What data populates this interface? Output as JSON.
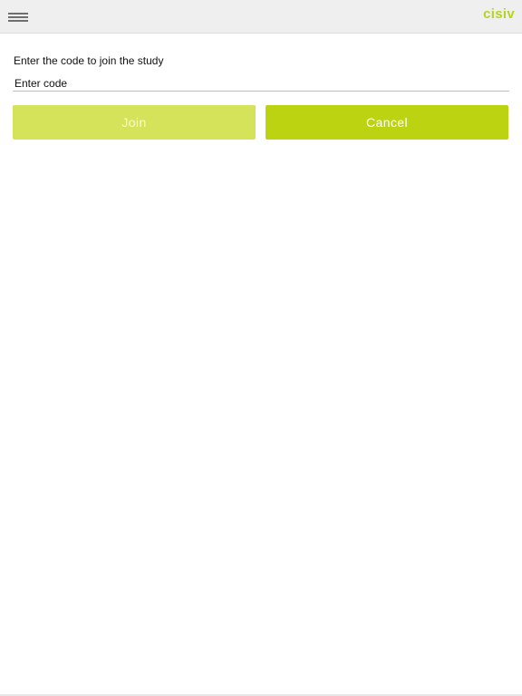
{
  "header": {
    "logo_text": "cisiv",
    "menu_icon": "hamburger-menu-icon",
    "accent_color": "#b8d21f"
  },
  "join_form": {
    "prompt": "Enter the code to join the study",
    "code_input": {
      "value": "",
      "placeholder": "Enter code"
    },
    "join_label": "Join",
    "cancel_label": "Cancel",
    "join_color": "#d5e35a",
    "cancel_color": "#bcd312"
  }
}
